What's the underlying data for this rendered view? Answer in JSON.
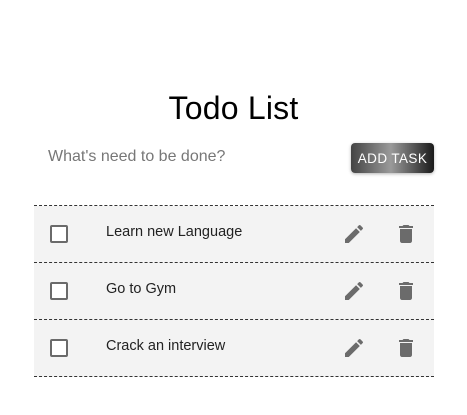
{
  "header": {
    "title": "Todo List"
  },
  "add_form": {
    "placeholder": "What's need to be done?",
    "value": "",
    "button_label": "ADD TASK"
  },
  "tasks": [
    {
      "label": "Learn new Language",
      "completed": false,
      "edit_icon": "pencil-icon",
      "delete_icon": "trash-icon"
    },
    {
      "label": "Go to Gym",
      "completed": false,
      "edit_icon": "pencil-icon",
      "delete_icon": "trash-icon"
    },
    {
      "label": "Crack an interview",
      "completed": false,
      "edit_icon": "pencil-icon",
      "delete_icon": "trash-icon"
    }
  ],
  "colors": {
    "icon": "#6b6b6b",
    "row_background": "#f3f3f3",
    "button_gradient": [
      "#444444",
      "#9a9a9a",
      "#1a1a1a"
    ]
  }
}
